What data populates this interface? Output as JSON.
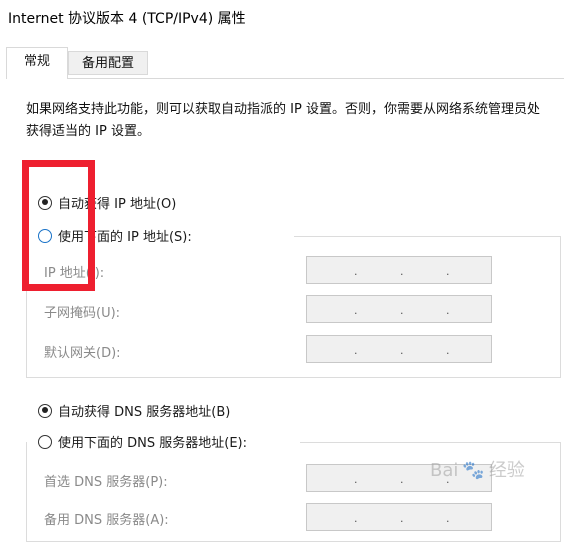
{
  "window": {
    "title": "Internet 协议版本 4 (TCP/IPv4) 属性"
  },
  "tabs": [
    {
      "label": "常规"
    },
    {
      "label": "备用配置"
    }
  ],
  "general": {
    "description": "如果网络支持此功能，则可以获取自动指派的 IP 设置。否则，你需要从网络系统管理员处获得适当的 IP 设置。",
    "auto_ip_label": "自动获得 IP 地址(O)",
    "manual_ip_label": "使用下面的 IP 地址(S):",
    "ip_fields": [
      {
        "label": "IP 地址(I):"
      },
      {
        "label": "子网掩码(U):"
      },
      {
        "label": "默认网关(D):"
      }
    ],
    "auto_dns_label": "自动获得 DNS 服务器地址(B)",
    "manual_dns_label": "使用下面的 DNS 服务器地址(E):",
    "dns_fields": [
      {
        "label": "首选 DNS 服务器(P):"
      },
      {
        "label": "备用 DNS 服务器(A):"
      }
    ]
  },
  "watermark": {
    "brand_left": "Bai",
    "brand_right": "经验"
  },
  "colors": {
    "highlight": "#ee1f2f",
    "radio_unchecked": "#1a73c8"
  }
}
